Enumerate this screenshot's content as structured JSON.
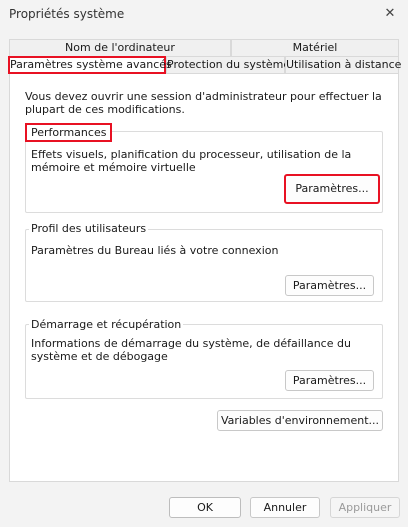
{
  "window": {
    "title": "Propriétés système",
    "close_glyph": "✕"
  },
  "tabs": {
    "computer_name": "Nom de l'ordinateur",
    "hardware": "Matériel",
    "advanced": "Paramètres système avancés",
    "protection": "Protection du système",
    "remote": "Utilisation à distance"
  },
  "advanced": {
    "intro": "Vous devez ouvrir une session d'administrateur pour effectuer la plupart de ces modifications.",
    "performance": {
      "title": "Performances",
      "description": "Effets visuels, planification du processeur, utilisation de la mémoire et mémoire virtuelle",
      "button": "Paramètres..."
    },
    "user_profiles": {
      "title": "Profil des utilisateurs",
      "description": "Paramètres du Bureau liés à votre connexion",
      "button": "Paramètres..."
    },
    "startup": {
      "title": "Démarrage et récupération",
      "description": "Informations de démarrage du système, de défaillance du système et de débogage",
      "button": "Paramètres..."
    },
    "env_button": "Variables d'environnement..."
  },
  "footer": {
    "ok": "OK",
    "cancel": "Annuler",
    "apply": "Appliquer"
  },
  "colors": {
    "highlight": "#e81123",
    "background": "#f3f3f3",
    "panel": "#ffffff"
  }
}
